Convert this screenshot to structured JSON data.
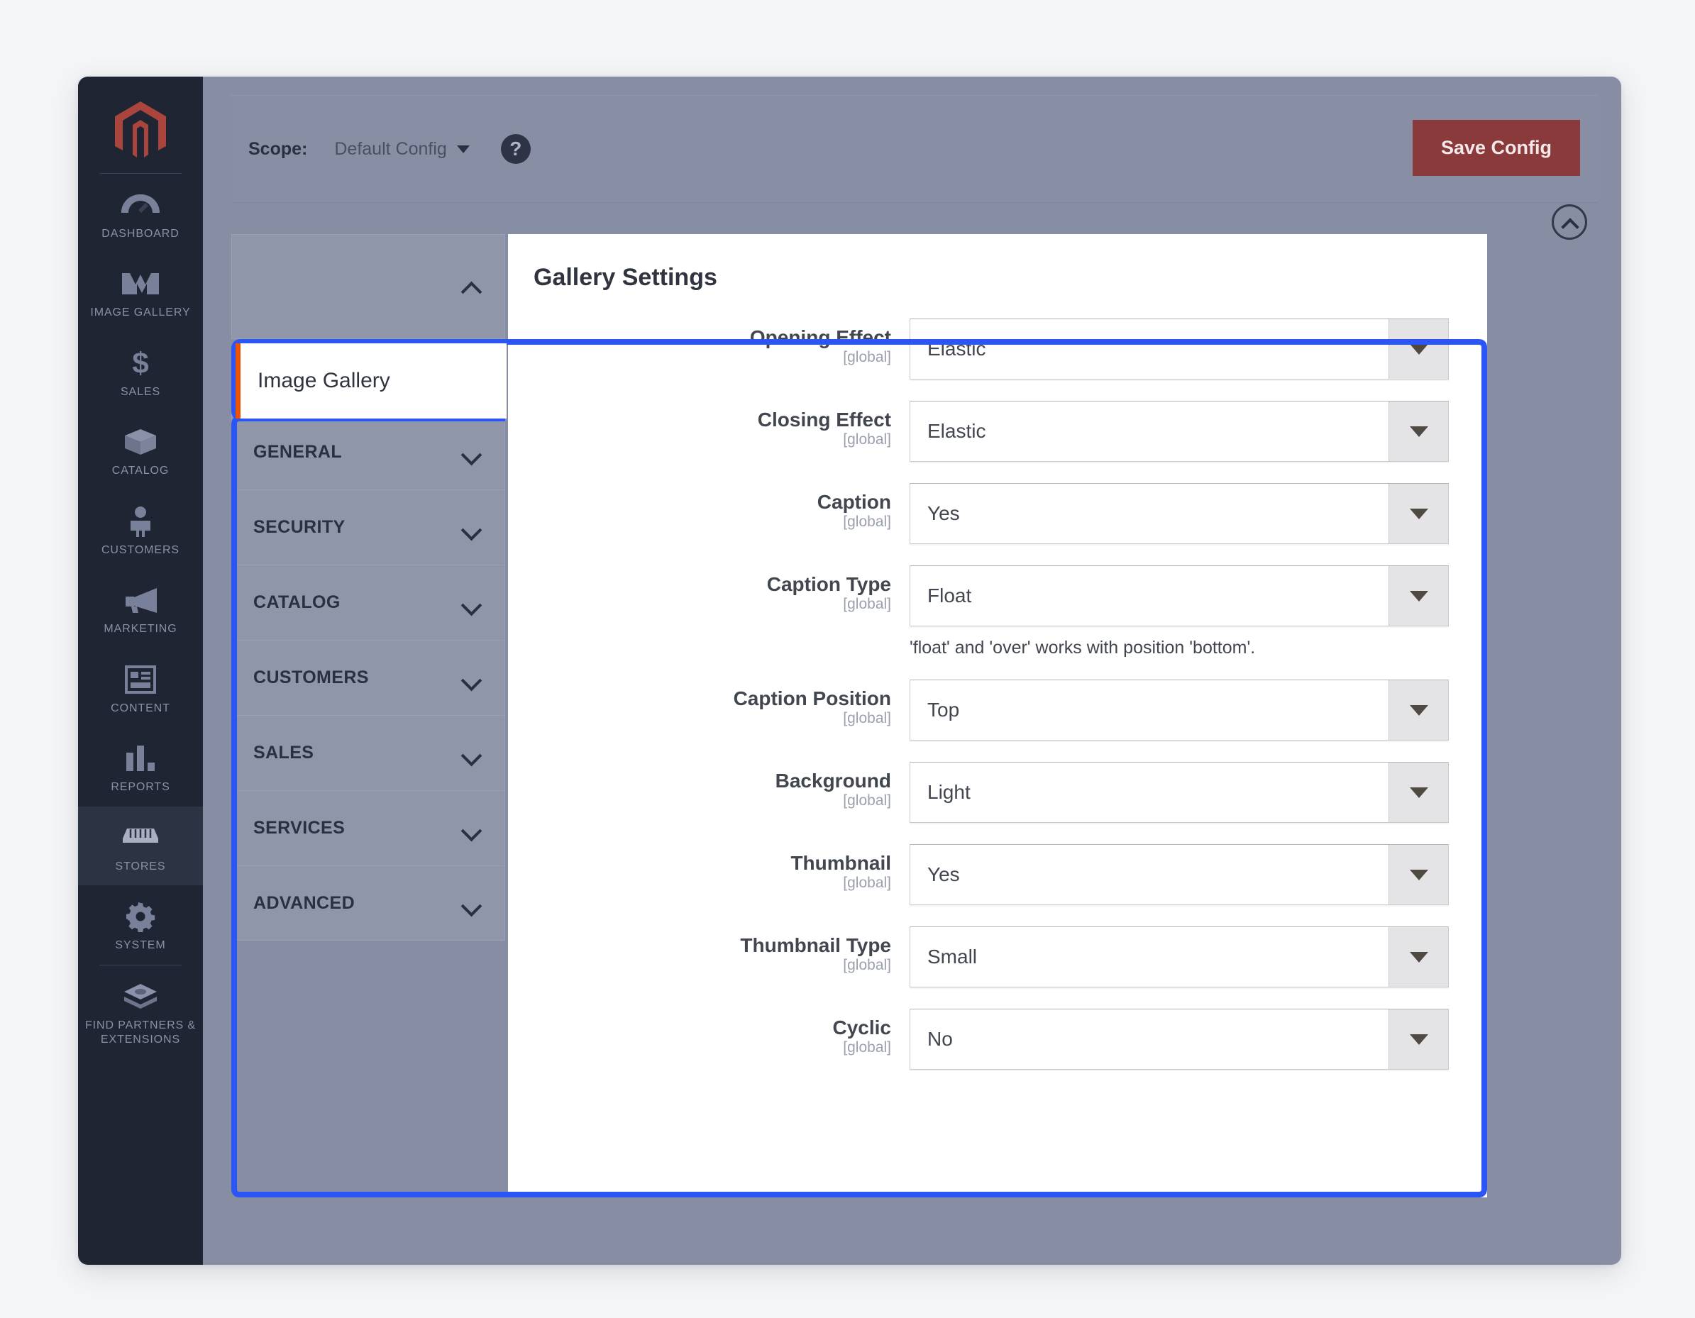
{
  "sidebar": {
    "logo": "magento-logo",
    "items": [
      {
        "label": "DASHBOARD",
        "icon": "dashboard-icon",
        "active": false
      },
      {
        "label": "IMAGE GALLERY",
        "icon": "image-gallery-icon",
        "active": false
      },
      {
        "label": "SALES",
        "icon": "dollar-icon",
        "active": false
      },
      {
        "label": "CATALOG",
        "icon": "box-icon",
        "active": false
      },
      {
        "label": "CUSTOMERS",
        "icon": "person-icon",
        "active": false
      },
      {
        "label": "MARKETING",
        "icon": "megaphone-icon",
        "active": false
      },
      {
        "label": "CONTENT",
        "icon": "layout-icon",
        "active": false
      },
      {
        "label": "REPORTS",
        "icon": "bar-chart-icon",
        "active": false
      },
      {
        "label": "STORES",
        "icon": "storefront-icon",
        "active": true
      },
      {
        "label": "SYSTEM",
        "icon": "gear-icon",
        "active": false
      },
      {
        "label": "FIND PARTNERS & EXTENSIONS",
        "icon": "extensions-icon",
        "active": false
      }
    ]
  },
  "header": {
    "scope_label": "Scope:",
    "scope_value": "Default Config",
    "help_icon": "question-mark-icon",
    "save_label": "Save Config"
  },
  "config_nav": {
    "top_section_label": "",
    "active_tab": "Image Gallery",
    "sections": [
      {
        "label": "GENERAL"
      },
      {
        "label": "SECURITY"
      },
      {
        "label": "CATALOG"
      },
      {
        "label": "CUSTOMERS"
      },
      {
        "label": "SALES"
      },
      {
        "label": "SERVICES"
      },
      {
        "label": "ADVANCED"
      }
    ]
  },
  "panel": {
    "title": "Gallery Settings",
    "scope_tag": "[global]",
    "collapse_icon": "chevron-up-circle-icon",
    "fields": [
      {
        "label": "Opening Effect",
        "scope": "[global]",
        "value": "Elastic",
        "hint": ""
      },
      {
        "label": "Closing Effect",
        "scope": "[global]",
        "value": "Elastic",
        "hint": ""
      },
      {
        "label": "Caption",
        "scope": "[global]",
        "value": "Yes",
        "hint": ""
      },
      {
        "label": "Caption Type",
        "scope": "[global]",
        "value": "Float",
        "hint": "'float' and 'over' works with position 'bottom'."
      },
      {
        "label": "Caption Position",
        "scope": "[global]",
        "value": "Top",
        "hint": ""
      },
      {
        "label": "Background",
        "scope": "[global]",
        "value": "Light",
        "hint": ""
      },
      {
        "label": "Thumbnail",
        "scope": "[global]",
        "value": "Yes",
        "hint": ""
      },
      {
        "label": "Thumbnail Type",
        "scope": "[global]",
        "value": "Small",
        "hint": ""
      },
      {
        "label": "Cyclic",
        "scope": "[global]",
        "value": "No",
        "hint": ""
      }
    ]
  },
  "colors": {
    "page_background": "#f4f5f7",
    "window_background": "#878ea4",
    "sidebar": "#1f2532",
    "magento_red": "#a9453d",
    "save_button": "#8b3a3c",
    "focus_blue": "#2b55f5",
    "tab_accent_orange": "#eb5202",
    "panel_white": "#ffffff"
  }
}
